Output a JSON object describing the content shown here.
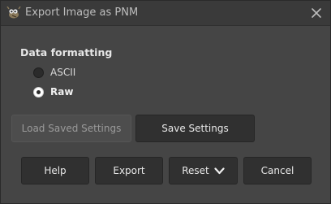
{
  "window": {
    "title": "Export Image as PNM"
  },
  "icons": {
    "app": "gimp-wilber-icon",
    "close": "close-icon",
    "reset_menu": "chevron-down-icon"
  },
  "data_formatting": {
    "title": "Data formatting",
    "options": [
      {
        "label": "ASCII",
        "selected": false
      },
      {
        "label": "Raw",
        "selected": true
      }
    ]
  },
  "settings": {
    "load_label": "Load Saved Settings",
    "save_label": "Save Settings"
  },
  "actions": {
    "help_label": "Help",
    "export_label": "Export",
    "reset_label": "Reset",
    "cancel_label": "Cancel"
  }
}
